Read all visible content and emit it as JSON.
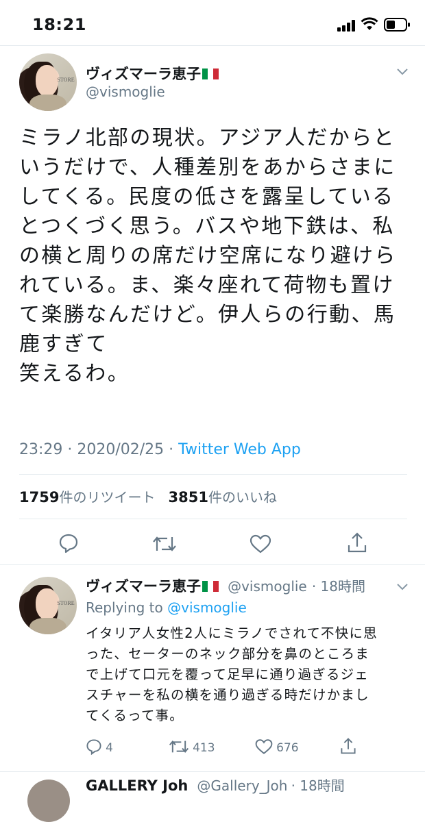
{
  "status_bar": {
    "time": "18:21"
  },
  "main_tweet": {
    "author_name": "ヴィズマーラ恵子",
    "handle": "@vismoglie",
    "text": "ミラノ北部の現状。アジア人だからと\nいうだけで、人種差別をあからさまに\nしてくる。民度の低さを露呈している\nとつくづく思う。バスや地下鉄は、私\nの横と周りの席だけ空席になり避けら\nれている。ま、楽々座れて荷物も置け\nて楽勝なんだけど。伊人らの行動、馬\n鹿すぎて\n笑えるわ。",
    "time": "23:29 · 2020/02/25 · ",
    "source": "Twitter Web App",
    "retweet_count": "1759",
    "retweet_label": "件のリツイート",
    "like_count": "3851",
    "like_label": "件のいいね"
  },
  "reply_tweet": {
    "author_name": "ヴィズマーラ恵子",
    "handle": "@vismoglie",
    "time": "· 18時間",
    "replying_prefix": "Replying to ",
    "replying_handle": "@vismoglie",
    "text": "イタリア人女性2人にミラノでされて不快に思\nった、セーターのネック部分を鼻のところま\nで上げて口元を覆って足早に通り過ぎるジェ\nスチャーを私の横を通り過ぎる時だけかまし\nてくるって事。",
    "reply_count": "4",
    "retweet_count": "413",
    "like_count": "676"
  },
  "next_tweet": {
    "author_name": "GALLERY Joh",
    "handle": "@Gallery_Joh",
    "time": "· 18時間"
  },
  "colors": {
    "accent": "#1da1f2",
    "secondary_text": "#657786",
    "divider": "#e6ecf0",
    "flag": [
      "#009246",
      "#ffffff",
      "#ce2b37"
    ]
  }
}
